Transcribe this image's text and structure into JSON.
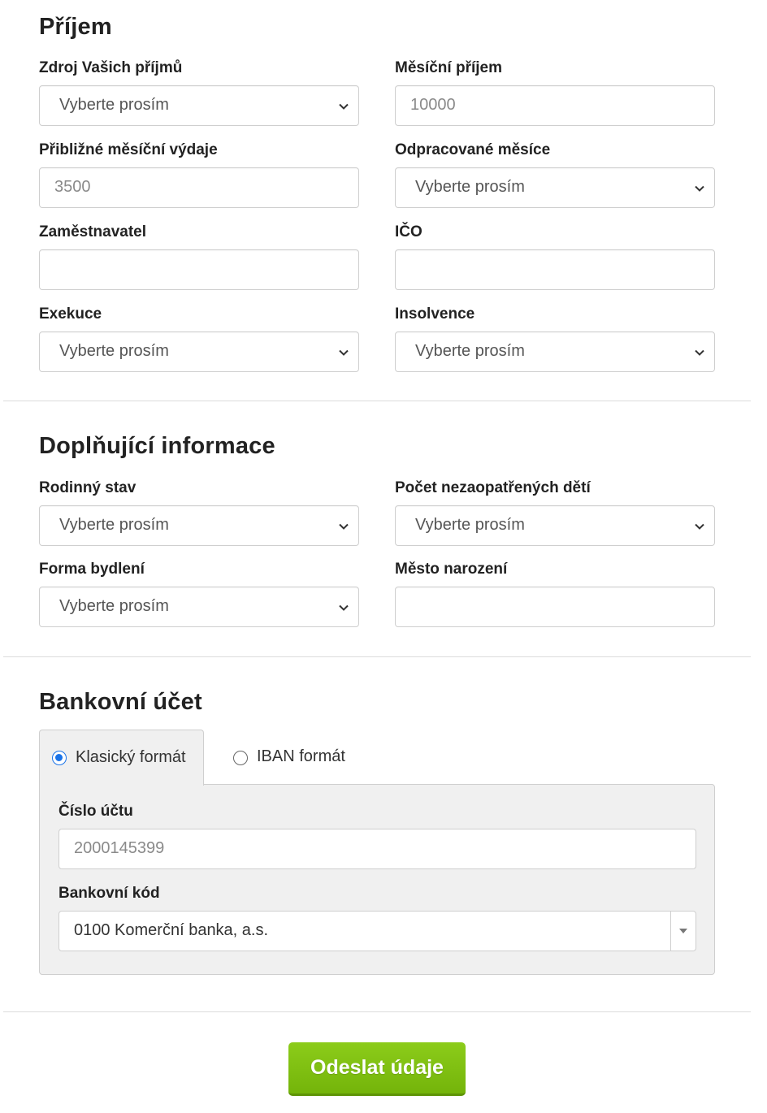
{
  "income": {
    "title": "Příjem",
    "source_label": "Zdroj Vašich příjmů",
    "source_value": "Vyberte prosím",
    "monthly_income_label": "Měsíční příjem",
    "monthly_income_placeholder": "10000",
    "expenses_label": "Přibližné měsíční výdaje",
    "expenses_placeholder": "3500",
    "months_worked_label": "Odpracované měsíce",
    "months_worked_value": "Vyberte prosím",
    "employer_label": "Zaměstnavatel",
    "employer_value": "",
    "ico_label": "IČO",
    "ico_value": "",
    "execution_label": "Exekuce",
    "execution_value": "Vyberte prosím",
    "insolvency_label": "Insolvence",
    "insolvency_value": "Vyberte prosím"
  },
  "additional": {
    "title": "Doplňující informace",
    "marital_label": "Rodinný stav",
    "marital_value": "Vyberte prosím",
    "children_label": "Počet nezaopatřených dětí",
    "children_value": "Vyberte prosím",
    "housing_label": "Forma bydlení",
    "housing_value": "Vyberte prosím",
    "birthplace_label": "Město narození",
    "birthplace_value": ""
  },
  "bank": {
    "title": "Bankovní účet",
    "tab_classic": "Klasický formát",
    "tab_iban": "IBAN formát",
    "selected_tab": "classic",
    "account_label": "Číslo účtu",
    "account_placeholder": "2000145399",
    "code_label": "Bankovní kód",
    "code_value": "0100 Komerční banka, a.s."
  },
  "submit_label": "Odeslat údaje",
  "colors": {
    "accent_green": "#7fc114",
    "radio_blue": "#1a73e8"
  }
}
